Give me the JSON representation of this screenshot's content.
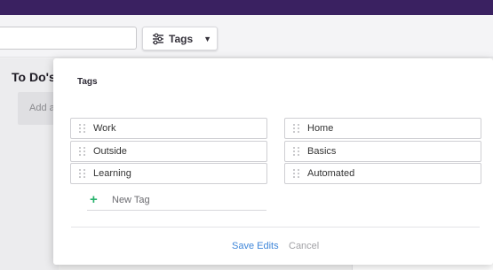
{
  "toolbar": {
    "search": {
      "value": "",
      "placeholder": ""
    },
    "tags_button": {
      "label": "Tags",
      "icon": "filter-sliders-icon"
    }
  },
  "board": {
    "column_title": "To Do's",
    "add_task_label": "Add a"
  },
  "tags_modal": {
    "title": "Tags",
    "left_tags": [
      "Work",
      "Outside",
      "Learning"
    ],
    "right_tags": [
      "Home",
      "Basics",
      "Automated"
    ],
    "new_tag_label": "New Tag",
    "save_label": "Save Edits",
    "cancel_label": "Cancel"
  },
  "colors": {
    "topbar": "#3a2161",
    "accent_link": "#3f86d9",
    "add_green": "#26b26c"
  }
}
